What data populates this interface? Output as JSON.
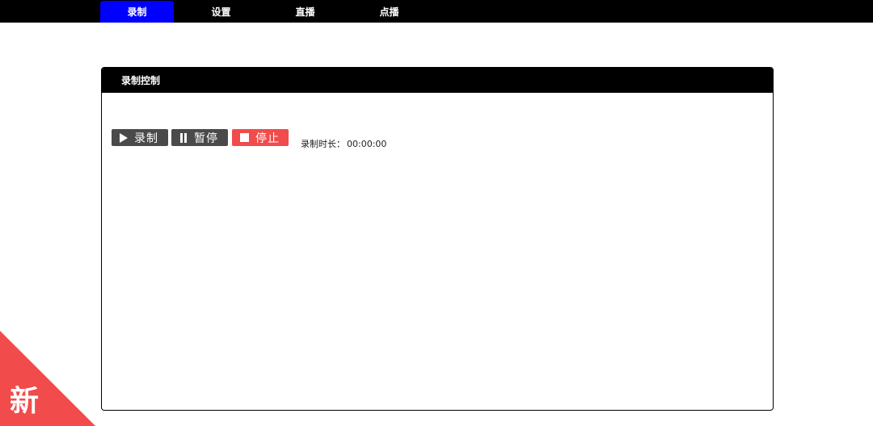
{
  "nav": {
    "tabs": [
      {
        "label": "录制",
        "active": true
      },
      {
        "label": "设置",
        "active": false
      },
      {
        "label": "直播",
        "active": false
      },
      {
        "label": "点播",
        "active": false
      }
    ]
  },
  "panel": {
    "title": "录制控制",
    "buttons": {
      "record": "录制",
      "pause": "暂停",
      "stop": "停止"
    },
    "duration_label": "录制时长：",
    "duration_value": "00:00:00"
  },
  "badge": {
    "text": "新"
  },
  "colors": {
    "topbar": "#000000",
    "active_tab": "#0000ff",
    "button_dark": "#4a4a4a",
    "button_stop": "#f24b4b",
    "badge": "#f24b4b"
  },
  "icons": {
    "record": "play-icon",
    "pause": "pause-icon",
    "stop": "stop-icon"
  }
}
